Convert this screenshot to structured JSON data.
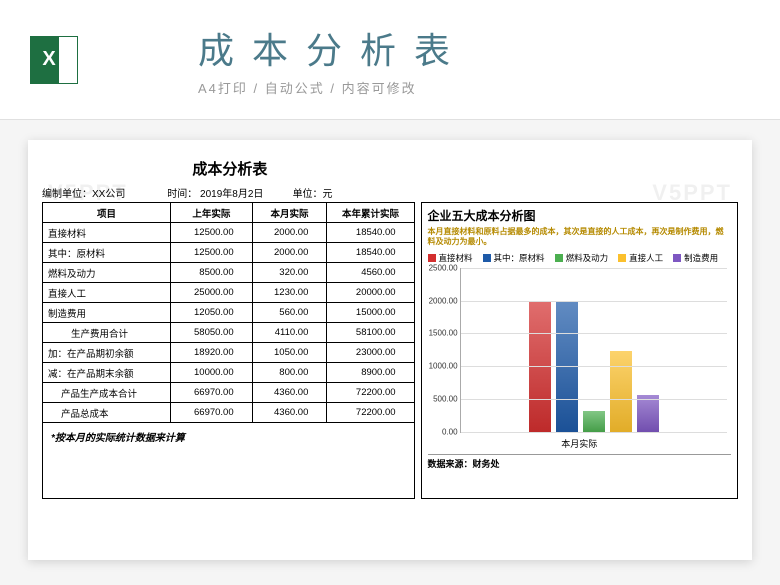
{
  "header": {
    "excel_letter": "X",
    "title": "成本分析表",
    "subtitle": "A4打印 / 自动公式 / 内容可修改"
  },
  "sheet": {
    "title": "成本分析表",
    "meta": {
      "org": "编制单位：XX公司",
      "time": "时间：   2019年8月2日",
      "unit": "单位：元"
    },
    "columns": [
      "项目",
      "上年实际",
      "本月实际",
      "本年累计实际"
    ],
    "rows": [
      {
        "label": "直接材料",
        "indent": 0,
        "vals": [
          "12500.00",
          "2000.00",
          "18540.00"
        ]
      },
      {
        "label": "其中：原材料",
        "indent": 0,
        "vals": [
          "12500.00",
          "2000.00",
          "18540.00"
        ]
      },
      {
        "label": "燃料及动力",
        "indent": 0,
        "vals": [
          "8500.00",
          "320.00",
          "4560.00"
        ]
      },
      {
        "label": "直接人工",
        "indent": 0,
        "vals": [
          "25000.00",
          "1230.00",
          "20000.00"
        ]
      },
      {
        "label": "制造费用",
        "indent": 0,
        "vals": [
          "12050.00",
          "560.00",
          "15000.00"
        ]
      },
      {
        "label": "生产费用合计",
        "indent": 2,
        "vals": [
          "58050.00",
          "4110.00",
          "58100.00"
        ]
      },
      {
        "label": "加：在产品期初余额",
        "indent": 0,
        "vals": [
          "18920.00",
          "1050.00",
          "23000.00"
        ]
      },
      {
        "label": "减：在产品期末余额",
        "indent": 0,
        "vals": [
          "10000.00",
          "800.00",
          "8900.00"
        ]
      },
      {
        "label": "产品生产成本合计",
        "indent": 1,
        "vals": [
          "66970.00",
          "4360.00",
          "72200.00"
        ]
      },
      {
        "label": "产品总成本",
        "indent": 1,
        "vals": [
          "66970.00",
          "4360.00",
          "72200.00"
        ]
      }
    ],
    "note": "*按本月的实际统计数据来计算"
  },
  "chart_data": {
    "type": "bar",
    "title": "企业五大成本分析图",
    "description": "本月直接材料和原料占据最多的成本，其次是直接的人工成本，再次是制作费用，燃料及动力为最小。",
    "categories": [
      "本月实际"
    ],
    "series": [
      {
        "name": "直接材料",
        "color": "#d32f2f",
        "values": [
          2000
        ]
      },
      {
        "name": "其中：原材料",
        "color": "#1e5aa8",
        "values": [
          2000
        ]
      },
      {
        "name": "燃料及动力",
        "color": "#4caf50",
        "values": [
          320
        ]
      },
      {
        "name": "直接人工",
        "color": "#fbc02d",
        "values": [
          1230
        ]
      },
      {
        "name": "制造费用",
        "color": "#7e57c2",
        "values": [
          560
        ]
      }
    ],
    "ylim": [
      0,
      2500
    ],
    "yticks": [
      0,
      500,
      1000,
      1500,
      2000,
      2500
    ],
    "source": "数据来源：财务处"
  },
  "watermark": "V5PPT"
}
